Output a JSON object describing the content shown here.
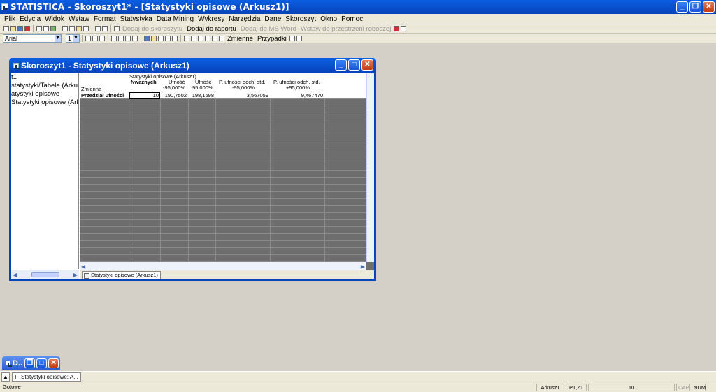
{
  "app": {
    "title": "STATISTICA - Skoroszyt1* - [Statystyki opisowe (Arkusz1)]"
  },
  "menu": [
    "Plik",
    "Edycja",
    "Widok",
    "Wstaw",
    "Format",
    "Statystyka",
    "Data Mining",
    "Wykresy",
    "Narzędzia",
    "Dane",
    "Skoroszyt",
    "Okno",
    "Pomoc"
  ],
  "toolbar": {
    "add_to_workbook": "Dodaj do skoroszytu",
    "add_to_report": "Dodaj do raportu",
    "add_to_msword": "Dodaj do MS Word",
    "insert_workspace": "Wstaw do przestrzeni roboczej",
    "font_name": "Arial",
    "font_size": "1",
    "variables": "Zmienne",
    "cases": "Przypadki"
  },
  "child_window": {
    "title": "Skoroszyt1 - Statystyki opisowe (Arkusz1)",
    "tree": [
      "t1",
      " statystyki/Tabele (Arkusz",
      "atystyki opisowe",
      "Statystyki opisowe (Arkusz"
    ],
    "sheet_title": "Statystyki opisowe (Arkusz1)",
    "tab_label": "Statystyki opisowe (Arkusz1)",
    "columns": {
      "variable": "Zmienna",
      "n_valid": "Nważnych",
      "conf_low": [
        "Ufność",
        "-95,000%"
      ],
      "conf_high": [
        "Ufność",
        "95,000%"
      ],
      "sd_low": [
        "P. ufności odch. std.",
        "-95,000%"
      ],
      "sd_high": [
        "P. ufności odch. std.",
        "+95,000%"
      ]
    },
    "row": {
      "label": "Przedział ufności",
      "n_valid": "10",
      "conf_low": "190,7502",
      "conf_high": "198,1698",
      "sd_low": "3,567059",
      "sd_high": "9,467470"
    }
  },
  "minimized": {
    "label": "D.."
  },
  "taskbar": {
    "item": "Statystyki opisowe: A..."
  },
  "status": {
    "ready": "Gotowe",
    "sheet": "Arkusz1",
    "cell": "P1,Z1",
    "value": "10",
    "cap": "CAP",
    "num": "NUM"
  }
}
